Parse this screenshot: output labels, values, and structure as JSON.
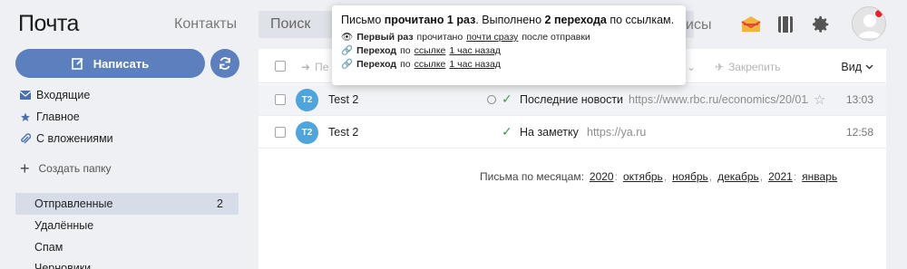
{
  "header": {
    "logo": "Почта",
    "contacts": "Контакты",
    "search_placeholder": "Поиск",
    "search_tail": "исы"
  },
  "sidebar": {
    "compose": "Написать",
    "items": [
      {
        "label": "Входящие",
        "icon": "inbox-icon"
      },
      {
        "label": "Главное",
        "icon": "star-icon"
      },
      {
        "label": "С вложениями",
        "icon": "paperclip-icon"
      }
    ],
    "create_folder": "Создать папку",
    "sent": {
      "label": "Отправленные",
      "count": "2"
    },
    "deleted": "Удалённые",
    "spam": "Спам",
    "drafts": "Черновики"
  },
  "toolbar": {
    "forward": "Пе",
    "pin": "Закрепить",
    "view": "Вид"
  },
  "messages": [
    {
      "avatar": "T2",
      "sender": "Test 2",
      "subject": "Последние новости",
      "snippet": "https://www.rbc.ru/economics/20/01/...",
      "time": "13:03"
    },
    {
      "avatar": "T2",
      "sender": "Test 2",
      "subject": "На заметку",
      "snippet": "https://ya.ru",
      "time": "12:58"
    }
  ],
  "months": {
    "label": "Письма по месяцам:",
    "year1": "2020",
    "m1": "октябрь",
    "m2": "ноябрь",
    "m3": "декабрь",
    "year2": "2021",
    "m4": "январь"
  },
  "tooltip": {
    "head_a": "Письмо ",
    "head_b": "прочитано 1 раз",
    "head_c": ". Выполнено ",
    "head_d": "2 перехода",
    "head_e": " по ссылкам.",
    "l1_a": "Первый раз",
    "l1_b": " прочитано ",
    "l1_c": "почти сразу",
    "l1_d": " после отправки",
    "l2_a": "Переход",
    "l2_b": " по ",
    "l2_c": "ссылке",
    "l2_d": "1 час назад",
    "l3_a": "Переход",
    "l3_b": " по ",
    "l3_c": "ссылке",
    "l3_d": "1 час назад"
  },
  "colors": {
    "accent": "#5b80bd",
    "avatar": "#4ea5dc",
    "check": "#3a9a55",
    "selected": "#d6dde8"
  }
}
